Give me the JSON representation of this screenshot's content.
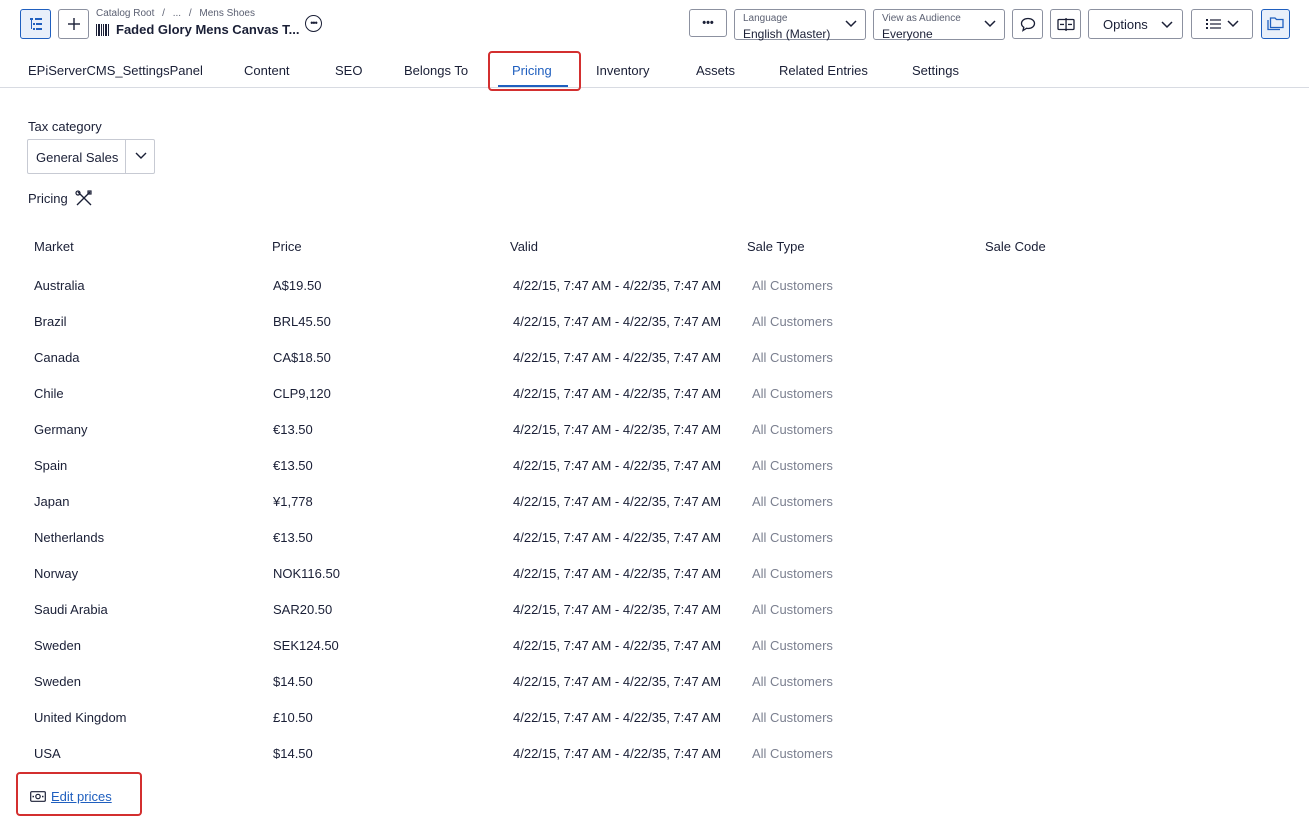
{
  "header": {
    "breadcrumb": [
      "Catalog Root",
      "/",
      "...",
      "/",
      "Mens Shoes"
    ],
    "title": "Faded Glory Mens Canvas T...",
    "language_label": "Language",
    "language_value": "English (Master)",
    "audience_label": "View as Audience",
    "audience_value": "Everyone",
    "options_label": "Options",
    "more_label": "•••"
  },
  "tabs": [
    {
      "label": "EPiServerCMS_SettingsPanel"
    },
    {
      "label": "Content"
    },
    {
      "label": "SEO"
    },
    {
      "label": "Belongs To"
    },
    {
      "label": "Pricing"
    },
    {
      "label": "Inventory"
    },
    {
      "label": "Assets"
    },
    {
      "label": "Related Entries"
    },
    {
      "label": "Settings"
    }
  ],
  "active_tab": "Pricing",
  "tax": {
    "label": "Tax category",
    "value": "General Sales"
  },
  "pricing": {
    "label": "Pricing",
    "columns": [
      "Market",
      "Price",
      "Valid",
      "Sale Type",
      "Sale Code"
    ],
    "rows": [
      {
        "market": "Australia",
        "price": "A$19.50",
        "valid": "4/22/15, 7:47 AM - 4/22/35, 7:47 AM",
        "sale_type": "All Customers"
      },
      {
        "market": "Brazil",
        "price": "BRL45.50",
        "valid": "4/22/15, 7:47 AM - 4/22/35, 7:47 AM",
        "sale_type": "All Customers"
      },
      {
        "market": "Canada",
        "price": "CA$18.50",
        "valid": "4/22/15, 7:47 AM - 4/22/35, 7:47 AM",
        "sale_type": "All Customers"
      },
      {
        "market": "Chile",
        "price": "CLP9,120",
        "valid": "4/22/15, 7:47 AM - 4/22/35, 7:47 AM",
        "sale_type": "All Customers"
      },
      {
        "market": "Germany",
        "price": "€13.50",
        "valid": "4/22/15, 7:47 AM - 4/22/35, 7:47 AM",
        "sale_type": "All Customers"
      },
      {
        "market": "Spain",
        "price": "€13.50",
        "valid": "4/22/15, 7:47 AM - 4/22/35, 7:47 AM",
        "sale_type": "All Customers"
      },
      {
        "market": "Japan",
        "price": "¥1,778",
        "valid": "4/22/15, 7:47 AM - 4/22/35, 7:47 AM",
        "sale_type": "All Customers"
      },
      {
        "market": "Netherlands",
        "price": "€13.50",
        "valid": "4/22/15, 7:47 AM - 4/22/35, 7:47 AM",
        "sale_type": "All Customers"
      },
      {
        "market": "Norway",
        "price": "NOK116.50",
        "valid": "4/22/15, 7:47 AM - 4/22/35, 7:47 AM",
        "sale_type": "All Customers"
      },
      {
        "market": "Saudi Arabia",
        "price": "SAR20.50",
        "valid": "4/22/15, 7:47 AM - 4/22/35, 7:47 AM",
        "sale_type": "All Customers"
      },
      {
        "market": "Sweden",
        "price": "SEK124.50",
        "valid": "4/22/15, 7:47 AM - 4/22/35, 7:47 AM",
        "sale_type": "All Customers"
      },
      {
        "market": "Sweden",
        "price": "$14.50",
        "valid": "4/22/15, 7:47 AM - 4/22/35, 7:47 AM",
        "sale_type": "All Customers"
      },
      {
        "market": "United Kingdom",
        "price": "£10.50",
        "valid": "4/22/15, 7:47 AM - 4/22/35, 7:47 AM",
        "sale_type": "All Customers"
      },
      {
        "market": "USA",
        "price": "$14.50",
        "valid": "4/22/15, 7:47 AM - 4/22/35, 7:47 AM",
        "sale_type": "All Customers"
      }
    ],
    "edit_link": "Edit prices"
  },
  "colors": {
    "accent": "#1f5fbf",
    "highlight": "#d32f2f",
    "muted_text": "#7a7f8f"
  }
}
